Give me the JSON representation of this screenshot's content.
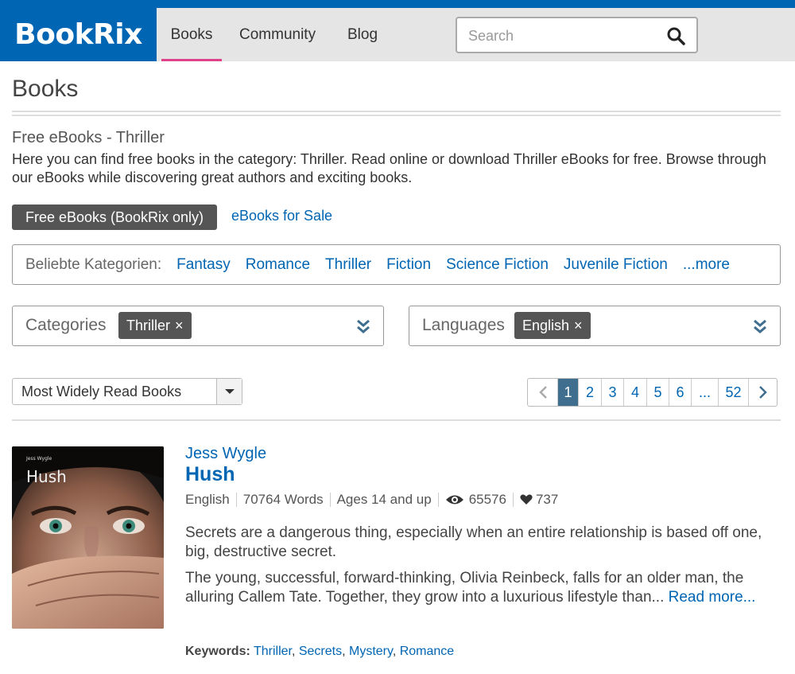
{
  "header": {
    "logo": "BookRix",
    "nav": [
      {
        "label": "Books",
        "active": true
      },
      {
        "label": "Community",
        "active": false
      },
      {
        "label": "Blog",
        "active": false
      }
    ],
    "search_placeholder": "Search"
  },
  "page": {
    "title": "Books",
    "subtitle": "Free eBooks - Thriller",
    "description": "Here you can find free books in the category: Thriller. Read online or download Thriller eBooks for free. Browse through our eBooks while discovering great authors and exciting books."
  },
  "toggle": {
    "free_label": "Free eBooks (BookRix only)",
    "sale_label": "eBooks for Sale"
  },
  "popular": {
    "label": "Beliebte Kategorien:",
    "categories": [
      "Fantasy",
      "Romance",
      "Thriller",
      "Fiction",
      "Science Fiction",
      "Juvenile Fiction",
      "...more"
    ]
  },
  "filters": {
    "categories": {
      "label": "Categories",
      "tag": "Thriller",
      "remove": "×"
    },
    "languages": {
      "label": "Languages",
      "tag": "English",
      "remove": "×"
    }
  },
  "sort": {
    "selected": "Most Widely Read Books"
  },
  "pagination": {
    "prev": "‹",
    "pages": [
      "1",
      "2",
      "3",
      "4",
      "5",
      "6",
      "...",
      "52"
    ],
    "current": "1",
    "next": "›"
  },
  "book": {
    "author": "Jess Wygle",
    "title": "Hush",
    "cover_title": "Hush",
    "cover_author": "Jess Wygle",
    "language": "English",
    "words": "70764 Words",
    "ages": "Ages 14 and up",
    "views": "65576",
    "likes": "737",
    "blurb1": "Secrets are a dangerous thing, especially when an entire relationship is based off one, big, destructive secret.",
    "blurb2": "The young, successful, forward-thinking, Olivia Reinbeck, falls for an older man, the alluring Callem Tate. Together, they grow into a luxurious lifestyle than...",
    "read_more": "Read more...",
    "keywords_label": "Keywords:",
    "keywords": [
      "Thriller",
      "Secrets",
      "Mystery",
      "Romance"
    ]
  },
  "colors": {
    "brand": "#0065b3",
    "nav_underline": "#e0428a",
    "tag_bg": "#555555",
    "active_page": "#3f6e8f"
  }
}
